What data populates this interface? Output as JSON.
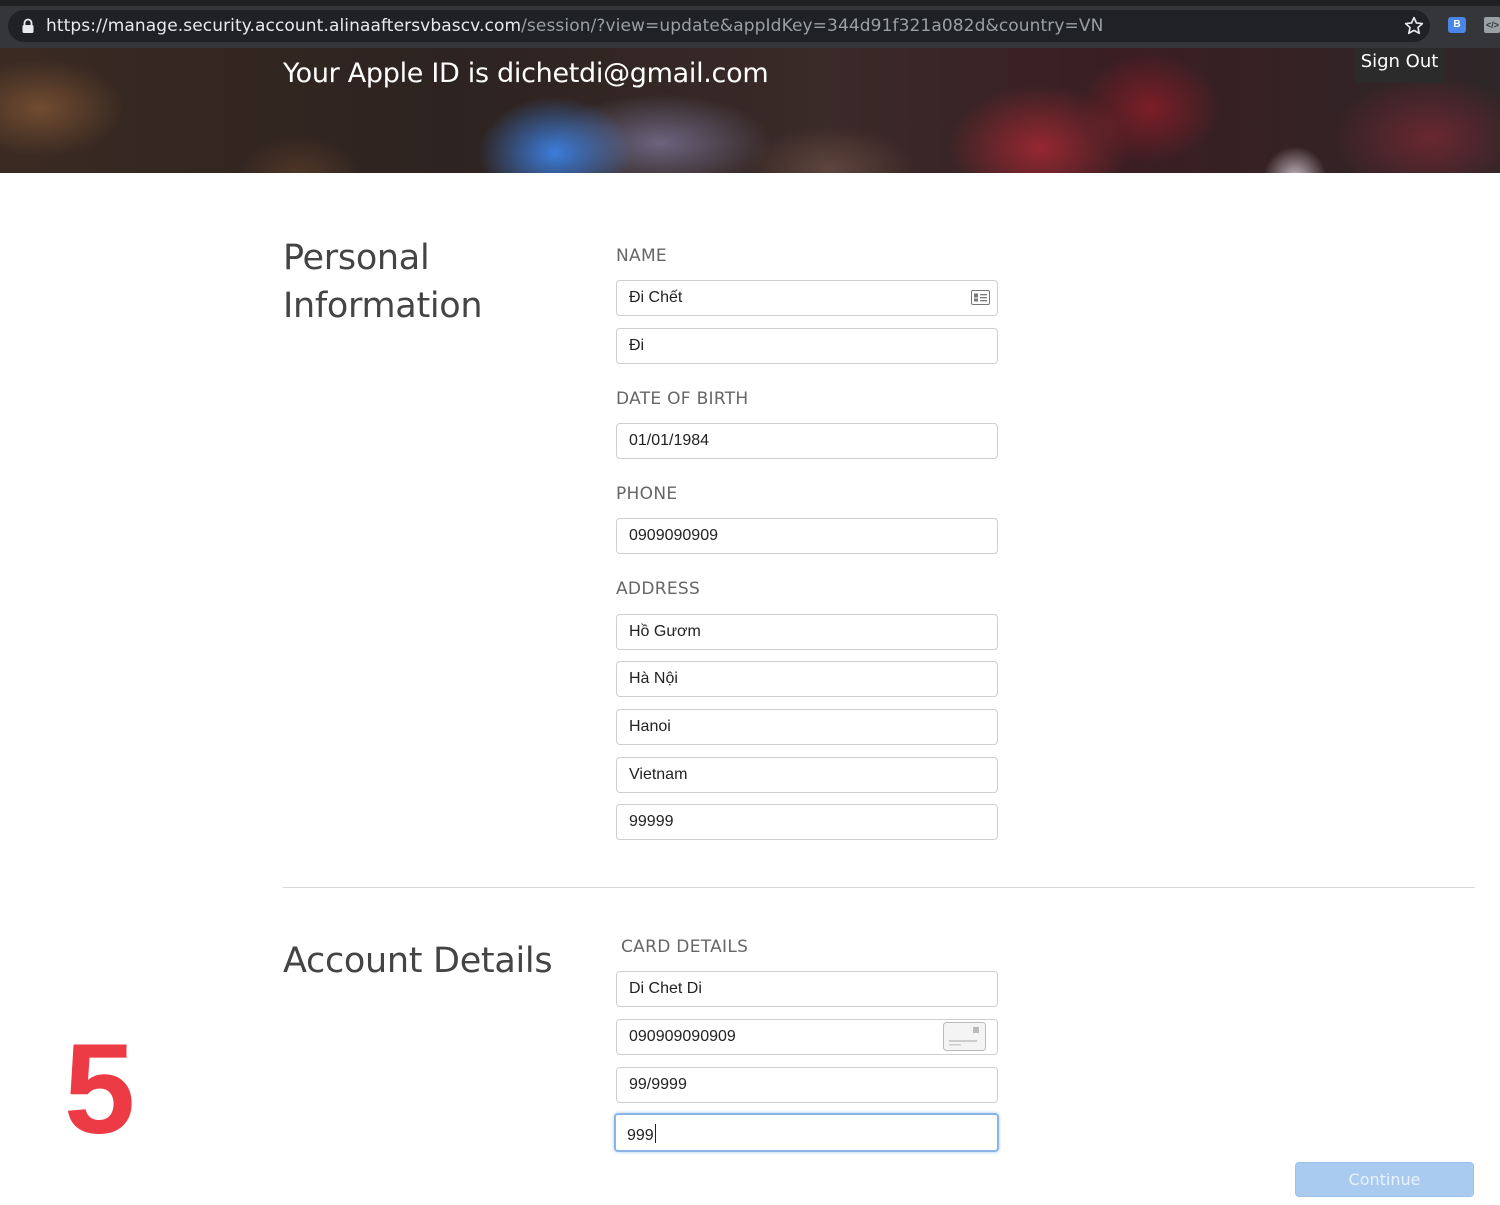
{
  "browser": {
    "url_host": "https://manage.security.account.alinaaftersvbascv.com",
    "url_rest": "/session/?view=update&appIdKey=344d91f321a082d&country=VN",
    "extensions": [
      "B",
      "</>"
    ]
  },
  "header": {
    "title": "Your Apple ID is dichetdi@gmail.com",
    "sign_out": "Sign Out"
  },
  "personal": {
    "title_line1": "Personal",
    "title_line2": "Information",
    "name_label": "NAME",
    "first_name": "Đi Chết",
    "last_name": "Đi",
    "dob_label": "DATE OF BIRTH",
    "dob": "01/01/1984",
    "phone_label": "PHONE",
    "phone": "0909090909",
    "address_label": "ADDRESS",
    "address_lines": [
      "Hồ Gươm",
      "Hà Nội",
      "Hanoi",
      "Vietnam",
      "99999"
    ]
  },
  "account": {
    "title": "Account Details",
    "card_label": "CARD DETAILS",
    "card_name": "Di Chet Di",
    "card_number": "090909090909",
    "expiry": "99/9999",
    "cvv": "999"
  },
  "overlay_number": "5",
  "continue_label": "Continue",
  "colors": {
    "accent_red": "#ec3b44",
    "continue_bg": "#a9cbef",
    "focus_border": "#88b4e6"
  }
}
